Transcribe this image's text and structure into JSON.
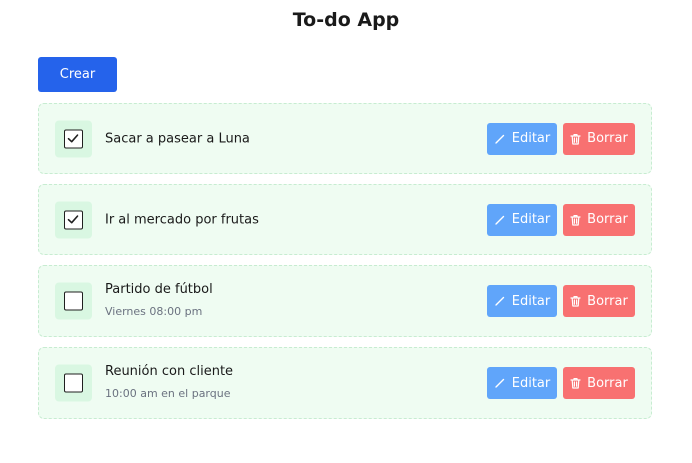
{
  "app": {
    "title": "To-do App"
  },
  "toolbar": {
    "create_label": "Crear"
  },
  "todos": [
    {
      "title": "Sacar a pasear a Luna",
      "subtitle": "",
      "done": true
    },
    {
      "title": "Ir al mercado por frutas",
      "subtitle": "",
      "done": true
    },
    {
      "title": "Partido de fútbol",
      "subtitle": "Viernes 08:00 pm",
      "done": false
    },
    {
      "title": "Reunión con cliente",
      "subtitle": "10:00 am en el parque",
      "done": false
    }
  ],
  "actions": {
    "edit_label": "Editar",
    "delete_label": "Borrar"
  },
  "colors": {
    "primary": "#2563eb",
    "edit": "#60a5fa",
    "delete": "#f87171",
    "card_bg": "#effcf2",
    "check_bg": "#d9f7e2"
  },
  "icons": {
    "edit": "pencil-icon",
    "delete": "trash-icon",
    "done": "check-icon"
  }
}
